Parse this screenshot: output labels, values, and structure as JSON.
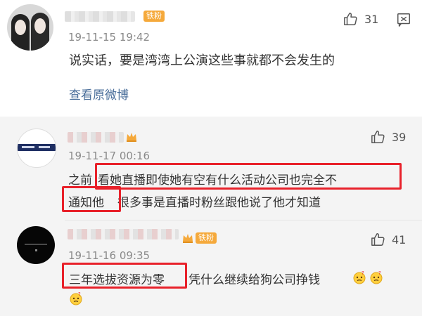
{
  "post": {
    "badge": "铁粉",
    "timestamp": "19-11-15 19:42",
    "like_count": "31",
    "text": "说实话，要是湾湾上公演这些事就都不会发生的",
    "view_original": "查看原微博"
  },
  "comments": [
    {
      "timestamp": "19-11-17 00:16",
      "like_count": "39",
      "line1a": "之前",
      "line1b": "看她直播即使她有空有什么活动公司也完全不",
      "line2a": "通知他",
      "line2b": "很多事是直播时粉丝跟他说了他才知道"
    },
    {
      "badge": "铁粉",
      "timestamp": "19-11-16 09:35",
      "like_count": "41",
      "line1a": "三年选拔资源为零",
      "line1b": "凭什么继续给狗公司挣钱"
    }
  ],
  "icons": {
    "like": "thumbs-up-icon",
    "reply": "reply-icon",
    "crown": "crown-icon",
    "emoji": "doubt-emoji-icon"
  },
  "colors": {
    "highlight": "#e8212a",
    "badge": "#f5a93b",
    "link": "#4a6e9a",
    "bottom_bg": "#f4f4f4"
  }
}
